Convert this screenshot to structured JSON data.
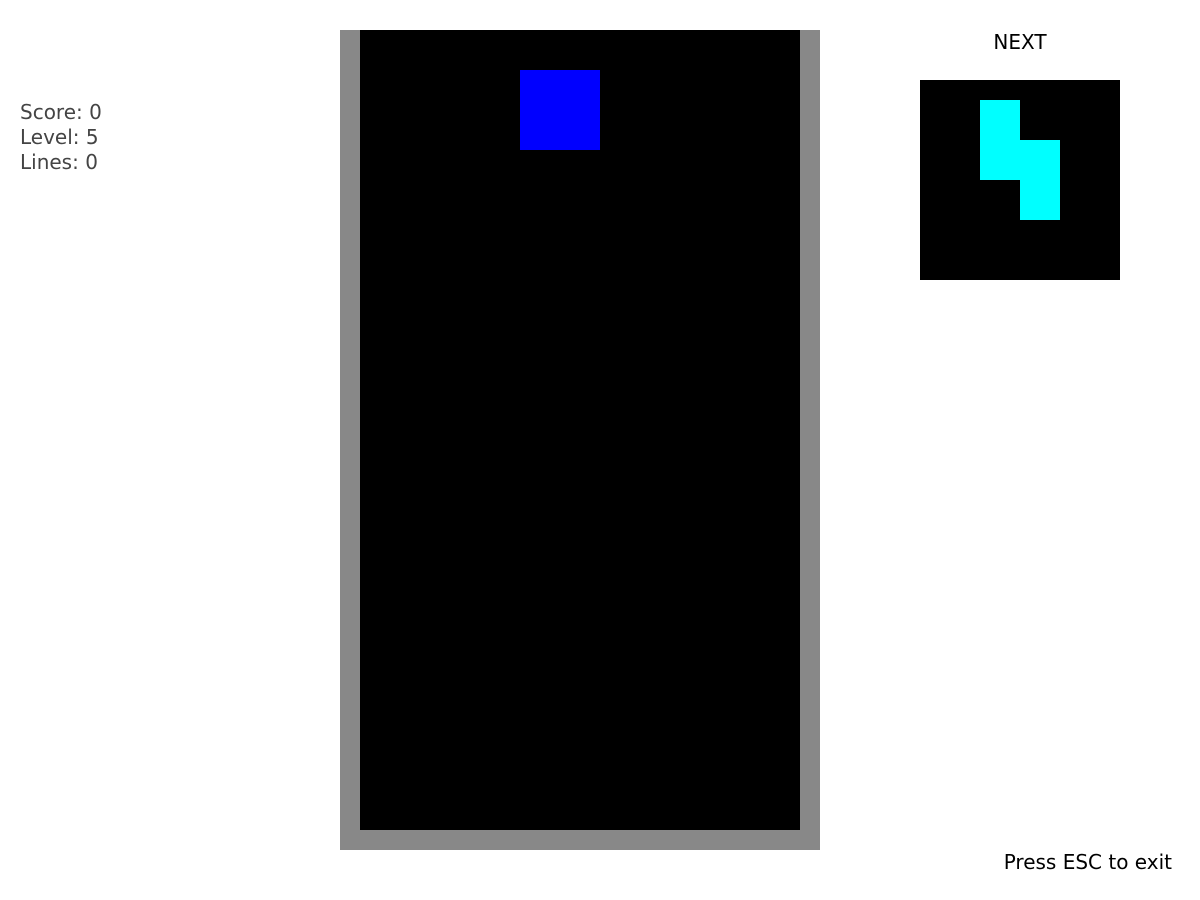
{
  "stats": {
    "score": "Score: 0",
    "level": "Level: 5",
    "lines": "Lines: 0"
  },
  "board": {
    "columns": 11,
    "rows": 20,
    "current_piece": {
      "name": "O-piece",
      "color": "#0000ff",
      "cells": [
        [
          4,
          1
        ],
        [
          5,
          1
        ],
        [
          4,
          2
        ],
        [
          5,
          2
        ]
      ]
    }
  },
  "next": {
    "label": "NEXT",
    "piece": {
      "name": "S-piece",
      "color": "#00ffff",
      "cells": [
        [
          1,
          0
        ],
        [
          1,
          1
        ],
        [
          2,
          1
        ],
        [
          2,
          2
        ]
      ]
    }
  },
  "hint": "Press ESC to exit",
  "colors": {
    "board_border": "#888888",
    "board_background": "#000000",
    "stats_text": "#444444"
  }
}
